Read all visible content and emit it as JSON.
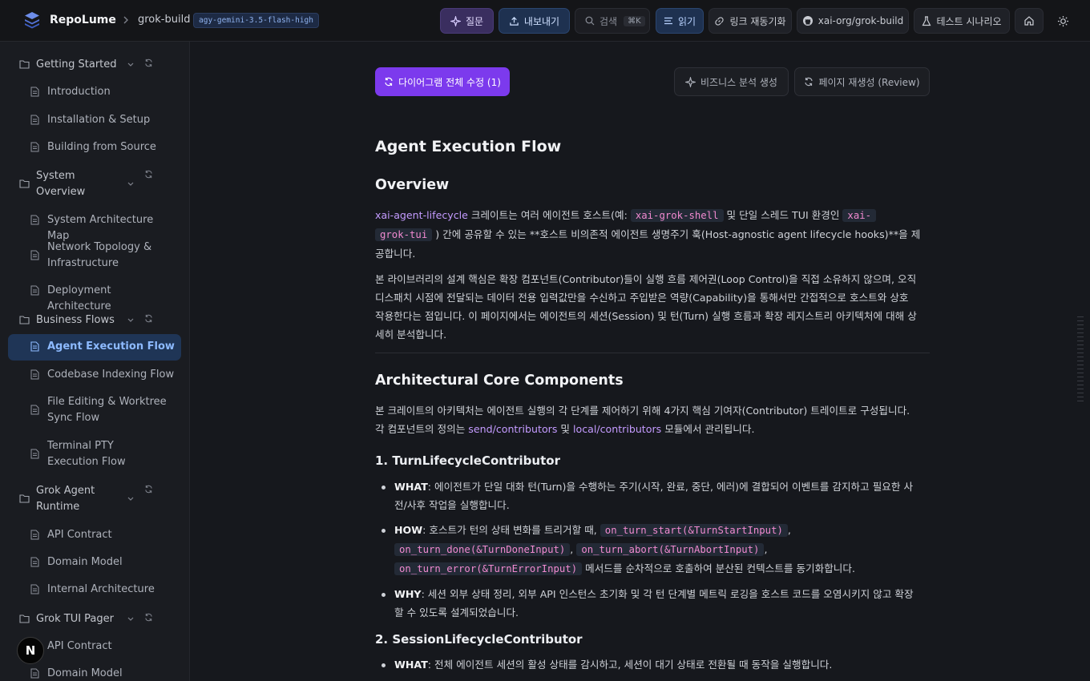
{
  "header": {
    "brand": "RepoLume",
    "repo": "grok-build",
    "model_badge": "agy-gemini-3.5-flash-high",
    "ask": "질문",
    "export": "내보내기",
    "search": "검색",
    "search_kbd": "⌘K",
    "read": "읽기",
    "link_sync": "링크 재동기화",
    "github": "xai-org/grok-build",
    "test": "테스트 시나리오"
  },
  "sidebar": {
    "sections": [
      {
        "label": "Getting Started",
        "items": [
          "Introduction",
          "Installation & Setup",
          "Building from Source"
        ]
      },
      {
        "label": "System Overview",
        "items": [
          "System Architecture Map",
          "Network Topology & Infrastructure",
          "Deployment Architecture"
        ]
      },
      {
        "label": "Business Flows",
        "items": [
          "Agent Execution Flow",
          "Codebase Indexing Flow",
          "File Editing & Worktree Sync Flow",
          "Terminal PTY Execution Flow"
        ]
      },
      {
        "label": "Grok Agent Runtime",
        "items": [
          "API Contract",
          "Domain Model",
          "Internal Architecture"
        ]
      },
      {
        "label": "Grok TUI Pager",
        "items": [
          "API Contract",
          "Domain Model"
        ]
      }
    ],
    "active": "Agent Execution Flow",
    "n_badge": "N"
  },
  "actions": {
    "fix_diagrams": "다이어그램 전체 수정 (1)",
    "biz_analysis": "비즈니스 분석 생성",
    "regen_page": "페이지 재생성 (Review)"
  },
  "article": {
    "title": "Agent Execution Flow",
    "overview_h": "Overview",
    "ov_p1": {
      "link": "xai-agent-lifecycle",
      "t1": " 크레이트는 여러 에이전트 호스트(예: ",
      "c1": "xai-grok-shell",
      "t2": " 및 단일 스레드 TUI 환경인 ",
      "c2a": "xai-",
      "c2b": "grok-tui",
      "t3": " ) 간에 공유할 수 있는 **호스트 비의존적 에이전트 생명주기 훅(Host-agnostic agent lifecycle hooks)**을 제",
      "t4": "공합니다."
    },
    "ov_p2": [
      "본 라이브러리의 설계 핵심은 확장 컴포넌트(Contributor)들이 실행 흐름 제어권(Loop Control)을 직접 소유하지 않으며, 오직",
      "디스패치 시점에 전달되는 데이터 전용 입력값만을 수신하고 주입받은 역량(Capability)을 통해서만 간접적으로 호스트와 상호",
      "작용한다는 점입니다. 이 페이지에서는 에이전트의 세션(Session) 및 턴(Turn) 실행 흐름과 확장 레지스트리 아키텍처에 대해 상",
      "세히 분석합니다."
    ],
    "arch_h": "Architectural Core Components",
    "arch_p": {
      "l1": "본 크레이트의 아키텍처는 에이전트 실행의 각 단계를 제어하기 위해 4가지 핵심 기여자(Contributor) 트레이트로 구성됩니다.",
      "l2a": "각 컴포넌트의 정의는 ",
      "link1": "send/contributors",
      "l2b": " 및 ",
      "link2": "local/contributors",
      "l2c": " 모듈에서 관리됩니다."
    },
    "turn_h": "1. TurnLifecycleContributor",
    "turn": {
      "what_label": "WHAT",
      "what_l1": ": 에이전트가 단일 대화 턴(Turn)을 수행하는 주기(시작, 완료, 중단, 에러)에 결합되어 이벤트를 감지하고 필요한 사",
      "what_l2": "전/사후 작업을 실행합니다.",
      "how_label": "HOW",
      "how_t1": ": 호스트가 턴의 상태 변화를 트리거할 때, ",
      "how_c1": "on_turn_start(&TurnStartInput)",
      "how_c2": "on_turn_done(&TurnDoneInput)",
      "how_c3": "on_turn_abort(&TurnAbortInput)",
      "how_c4": "on_turn_error(&TurnErrorInput)",
      "comma": ",",
      "how_t2": " 메서드를 순차적으로 호출하여 분산된 컨텍스트를 동기화합니다.",
      "why_label": "WHY",
      "why_l1": ": 세션 외부 상태 정리, 외부 API 인스턴스 초기화 및 각 턴 단계별 메트릭 로깅을 호스트 코드를 오염시키지 않고 확장",
      "why_l2": "할 수 있도록 설계되었습니다."
    },
    "session_h": "2. SessionLifecycleContributor",
    "session": {
      "what_label": "WHAT",
      "what_text": ": 전체 에이전트 세션의 활성 상태를 감시하고, 세션이 대기 상태로 전환될 때 동작을 실행합니다."
    }
  }
}
